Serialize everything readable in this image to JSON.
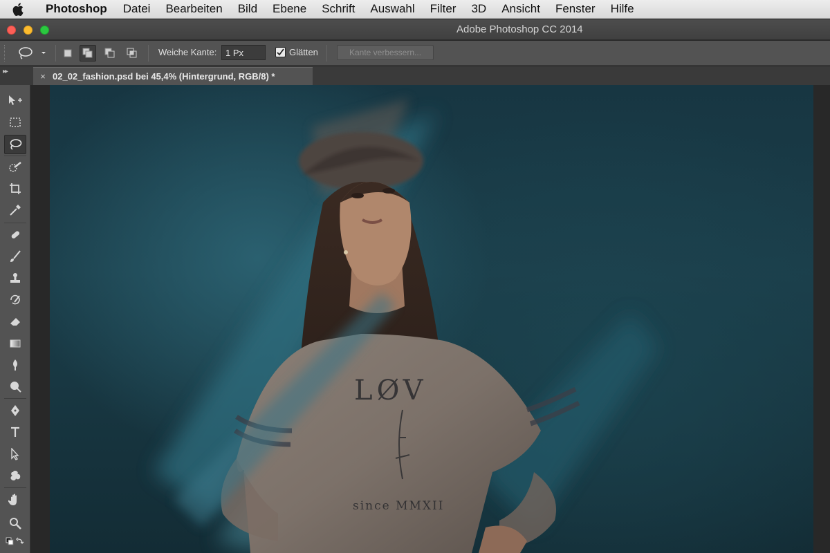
{
  "menubar": {
    "app": "Photoshop",
    "items": [
      "Datei",
      "Bearbeiten",
      "Bild",
      "Ebene",
      "Schrift",
      "Auswahl",
      "Filter",
      "3D",
      "Ansicht",
      "Fenster",
      "Hilfe"
    ]
  },
  "window": {
    "title": "Adobe Photoshop CC 2014"
  },
  "options": {
    "feather_label": "Weiche Kante:",
    "feather_value": "1 Px",
    "antialias_label": "Glätten",
    "antialias_checked": true,
    "refine_edge_label": "Kante verbessern..."
  },
  "document": {
    "tab_close": "×",
    "tab_label": "02_02_fashion.psd bei 45,4% (Hintergrund, RGB/8) *"
  },
  "canvas": {
    "shirt_text_top": "LØV",
    "shirt_text_bottom": "since MMXII"
  },
  "colors": {
    "panel": "#535353",
    "background_teal": "#1b3e4a",
    "accent_teal": "#2d6676"
  },
  "tools": [
    "move-tool-icon",
    "marquee-tool-icon",
    "lasso-tool-icon",
    "quick-selection-tool-icon",
    "crop-tool-icon",
    "eyedropper-tool-icon",
    "healing-brush-tool-icon",
    "brush-tool-icon",
    "clone-stamp-tool-icon",
    "history-brush-tool-icon",
    "eraser-tool-icon",
    "gradient-tool-icon",
    "blur-tool-icon",
    "dodge-tool-icon",
    "pen-tool-icon",
    "type-tool-icon",
    "path-selection-tool-icon",
    "custom-shape-tool-icon",
    "hand-tool-icon",
    "zoom-tool-icon"
  ]
}
